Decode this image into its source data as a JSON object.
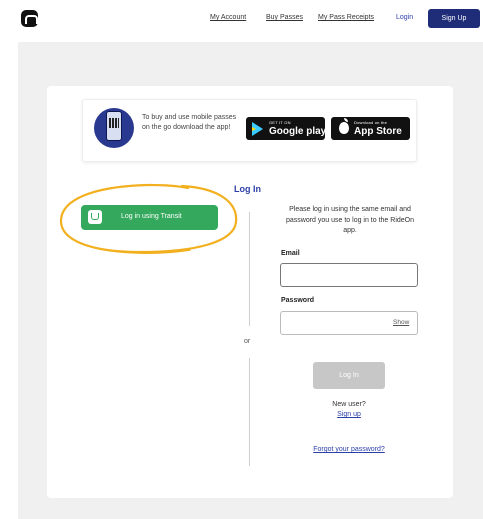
{
  "header": {
    "logo_icon": "m-logo-icon",
    "nav": [
      "My Account",
      "Buy Passes",
      "My Pass Receipts"
    ],
    "login_label": "Login",
    "signup_label": "Sign Up"
  },
  "promo": {
    "text": "To buy and use mobile passes on the go download the app!",
    "google_small": "GET IT ON",
    "google_big": "Google play",
    "apple_small": "Download on the",
    "apple_big": "App Store"
  },
  "login": {
    "title": "Log In",
    "transit_button_label": "Log in using Transit",
    "or_label": "or",
    "instructions": "Please log in using the same email and password you use to log in to the RideOn app.",
    "email_label": "Email",
    "email_value": "",
    "password_label": "Password",
    "password_value": "",
    "show_label": "Show",
    "login_button_label": "Log In",
    "new_user_label": "New user?",
    "signup_link_label": "Sign up",
    "forgot_label": "Forgot your password?"
  },
  "colors": {
    "brand_navy": "#1f2d78",
    "link_blue": "#2c3fa8",
    "transit_green": "#34a95d",
    "highlight_yellow": "#f2b01e",
    "disabled_gray": "#c7c7c7"
  }
}
